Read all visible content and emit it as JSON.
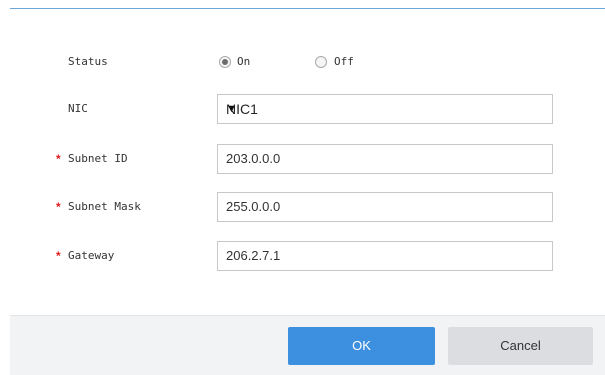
{
  "form": {
    "status": {
      "label": "Status",
      "options": [
        {
          "label": "On",
          "checked": true
        },
        {
          "label": "Off",
          "checked": false
        }
      ]
    },
    "nic": {
      "label": "NIC",
      "selected": "NIC1",
      "arrow": "▼"
    },
    "subnet_id": {
      "required_mark": "*",
      "label": "Subnet ID",
      "value": "203.0.0.0"
    },
    "subnet_mask": {
      "required_mark": "*",
      "label": "Subnet Mask",
      "value": "255.0.0.0"
    },
    "gateway": {
      "required_mark": "*",
      "label": "Gateway",
      "value": "206.2.7.1"
    }
  },
  "footer": {
    "ok_label": "OK",
    "cancel_label": "Cancel"
  },
  "colors": {
    "primary": "#3d8fe0",
    "required": "#e02020",
    "footer_bg": "#f2f3f5"
  }
}
